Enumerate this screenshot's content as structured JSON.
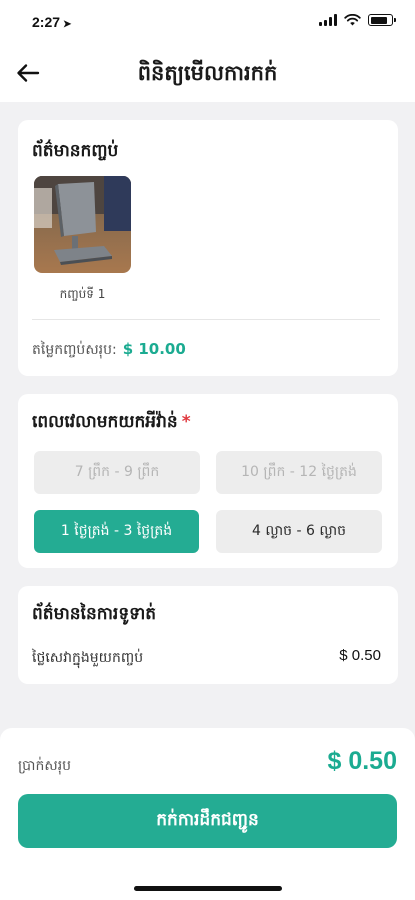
{
  "status_bar": {
    "time": "2:27",
    "location_icon": "location-arrow-icon",
    "battery_level": 0.8
  },
  "header": {
    "title": "ពិនិត្យមើលការកក់",
    "back_icon": "arrow-left-icon"
  },
  "order_info": {
    "title": "ព័ត៌មានកញ្ចប់",
    "package_label": "កញ្ចប់ទី 1",
    "total_label": "តម្លៃកញ្ចប់សរុប:",
    "total_amount": "$ 10.00"
  },
  "pickup_time": {
    "title": "ពេលវេលាមកយកអីវ៉ាន់",
    "required_mark": "*",
    "slots": [
      {
        "label": "7 ព្រឹក - 9 ព្រឹក",
        "state": "disabled"
      },
      {
        "label": "10 ព្រឹក - 12 ថ្ងៃត្រង់",
        "state": "disabled"
      },
      {
        "label": "1 ថ្ងៃត្រង់ - 3 ថ្ងៃត្រង់",
        "state": "selected"
      },
      {
        "label": "4 ល្ងាច - 6 ល្ងាច",
        "state": "available"
      }
    ]
  },
  "payment_info": {
    "title": "ព័ត៌មាននៃការទូទាត់",
    "fee_label": "ថ្លៃសេវាក្នុងមួយកញ្ចប់",
    "fee_value": "$ 0.50"
  },
  "summary": {
    "total_label": "ប្រាក់សរុប",
    "total_amount": "$ 0.50",
    "button_label": "កក់ការដឹកជញ្ជូន"
  },
  "colors": {
    "accent": "#24ac93",
    "accent_text": "#1bab91",
    "required": "#e0383e",
    "page_background": "#f1f1f3"
  }
}
